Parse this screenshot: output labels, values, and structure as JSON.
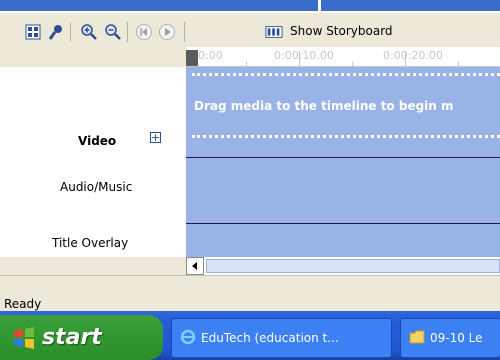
{
  "toolbar": {
    "storyboard_label": "Show Storyboard",
    "icons": [
      "narrate-icon",
      "set-audio-levels-icon",
      "zoom-in-icon",
      "zoom-out-icon",
      "rewind-icon",
      "play-icon",
      "storyboard-icon"
    ]
  },
  "ruler": {
    "labels": [
      "0:00",
      "0:00:10.00",
      "0:00:20.00"
    ]
  },
  "tracks": {
    "video_label": "Video",
    "video_message": "Drag media to the timeline to begin m",
    "audio_label": "Audio/Music",
    "title_label": "Title Overlay"
  },
  "status": {
    "text": "Ready"
  },
  "taskbar": {
    "start_label": "start",
    "buttons": [
      {
        "label": "EduTech (education t...",
        "icon": "internet-explorer-icon"
      },
      {
        "label": "09-10 Le",
        "icon": "folder-icon"
      }
    ]
  },
  "colors": {
    "track_bg": "#99b3e7",
    "taskbar_blue": "#245dd8",
    "start_green": "#329a32"
  }
}
